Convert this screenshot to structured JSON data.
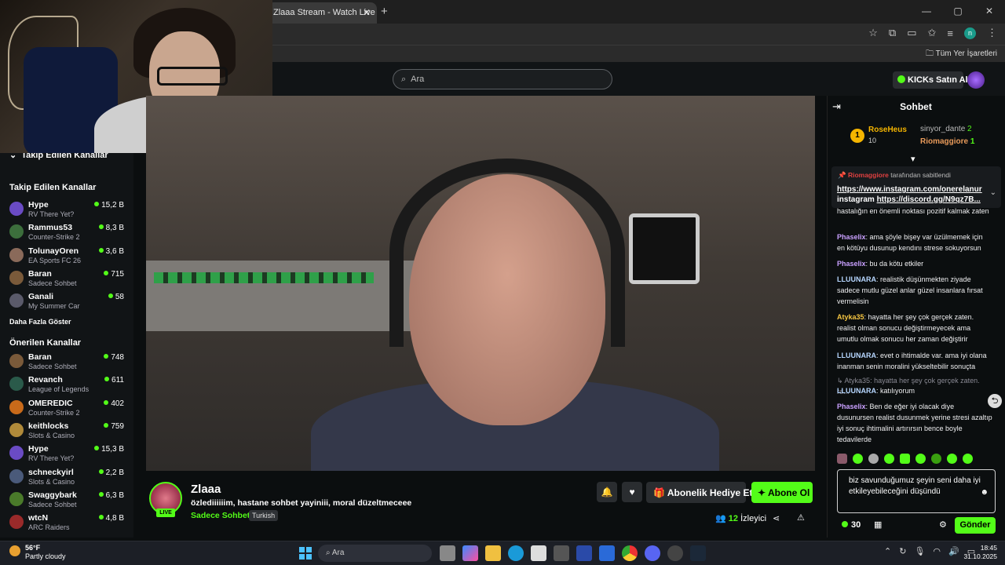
{
  "browser": {
    "tab_title": "Zlaaa Stream - Watch Live o",
    "new_tab": "+",
    "window_controls": [
      "—",
      "▢",
      "✕"
    ],
    "profile_initial": "n",
    "bookmarks_all": "Tüm Yer İşaretleri"
  },
  "header": {
    "search_placeholder": "Ara",
    "kicks_button": "KICKs Satın Al"
  },
  "sidebar": {
    "followed_collapsed": "Takip Edilen Kanallar",
    "followed_title": "Takip Edilen Kanallar",
    "followed": [
      {
        "name": "Hype",
        "category": "RV There Yet?",
        "viewers": "15,2 B",
        "color": "#6a4bc4"
      },
      {
        "name": "Rammus53",
        "category": "Counter-Strike 2",
        "viewers": "8,3 B",
        "color": "#3c6e3c"
      },
      {
        "name": "TolunayOren",
        "category": "EA Sports FC 26",
        "viewers": "3,6 B",
        "color": "#8a6a5a"
      },
      {
        "name": "Baran",
        "category": "Sadece Sohbet",
        "viewers": "715",
        "color": "#7a5a3a"
      },
      {
        "name": "Ganali",
        "category": "My Summer Car",
        "viewers": "58",
        "color": "#5a5a6a"
      }
    ],
    "show_more": "Daha Fazla Göster",
    "recommended_title": "Önerilen Kanallar",
    "recommended": [
      {
        "name": "Baran",
        "category": "Sadece Sohbet",
        "viewers": "748",
        "color": "#7a5a3a"
      },
      {
        "name": "Revanch",
        "category": "League of Legends",
        "viewers": "611",
        "color": "#2a5a4a"
      },
      {
        "name": "OMEREDIC",
        "category": "Counter-Strike 2",
        "viewers": "402",
        "color": "#c86a1a"
      },
      {
        "name": "keithlocks",
        "category": "Slots & Casino",
        "viewers": "759",
        "color": "#b08a3a"
      },
      {
        "name": "Hype",
        "category": "RV There Yet?",
        "viewers": "15,3 B",
        "color": "#6a4bc4"
      },
      {
        "name": "schneckyirl",
        "category": "Slots & Casino",
        "viewers": "2,2 B",
        "color": "#4a5a7a"
      },
      {
        "name": "Swaggybark",
        "category": "Sadece Sohbet",
        "viewers": "6,3 B",
        "color": "#4a7a2a"
      },
      {
        "name": "wtcN",
        "category": "ARC Raiders",
        "viewers": "4,8 B",
        "color": "#9a2a2a"
      }
    ]
  },
  "stream": {
    "streamer": "Zlaaa",
    "live": "LIVE",
    "title": "özlediiiiiim, hastane sohbet yayiniii, moral düzeltmeceee",
    "category": "Sadece Sohbet",
    "language": "Turkish",
    "gift_sub": "Abonelik Hediye Et",
    "subscribe": "Abone Ol",
    "viewer_count": "12",
    "viewer_label": "İzleyici"
  },
  "chat": {
    "title": "Sohbet",
    "leaderboard": [
      {
        "rank": "1",
        "name": "RoseHeus",
        "count": "10"
      },
      {
        "name": "sinyor_dante",
        "count": "2"
      },
      {
        "name": "Riomaggiore",
        "count": "1"
      }
    ],
    "pinned_by_user": "Riomaggiore",
    "pinned_by_text": "tarafından sabitlendi",
    "pinned_line1": "https://www.instagram.com/onerelanur",
    "pinned_line2_prefix": "instagram ",
    "pinned_line2_link": "https://discord.gg/N9qz7B...",
    "messages": [
      {
        "user": "",
        "color": "#efeff1",
        "text": "hastalığın en önemli noktası pozitif kalmak zaten"
      },
      {
        "user": "Phaselix",
        "color": "#c9a0ff",
        "text": "ama şöyle bişey var üzülmemek için en kötüyu dusunup kendını strese sokuyorsun"
      },
      {
        "user": "Phaselix",
        "color": "#c9a0ff",
        "text": "bu da kötu etkiler"
      },
      {
        "user": "LLUUNARA",
        "color": "#b7d7ff",
        "text": "realistik düşünmekten ziyade sadece mutlu güzel anlar güzel insanlara fırsat vermelisin"
      },
      {
        "user": "Atyka35",
        "color": "#f5c542",
        "text": "hayatta her şey çok gerçek zaten. realist olman sonucu değiştirmeyecek ama umutlu olmak sonucu her zaman değiştirir"
      },
      {
        "user": "LLUUNARA",
        "color": "#b7d7ff",
        "text": "evet o ihtimalde var. ama iyi olana inanman senin moralini yükseltebilir sonuçta"
      },
      {
        "user": "",
        "color": "#8a8a94",
        "text": "↳ Atyka35: hayatta her şey çok gerçek zaten. re..."
      },
      {
        "user": "LLUUNARA",
        "color": "#b7d7ff",
        "text": "katılıyorum"
      },
      {
        "user": "Phaselix",
        "color": "#c9a0ff",
        "text": "Ben de eğer iyi olacak diye dusunursen realist dusunmek yerine stresi azaltıp iyi sonuç ihtimalini artırırsın bence boyle tedavilerde"
      }
    ],
    "input_text": "biz savunduğumuz şeyin seni daha iyi etkileyebileceğini düşündü",
    "points": "30",
    "send": "Gönder"
  },
  "taskbar": {
    "temp": "56°F",
    "weather": "Partly cloudy",
    "search": "Ara",
    "time": "18:45",
    "date": "31.10.2025"
  }
}
